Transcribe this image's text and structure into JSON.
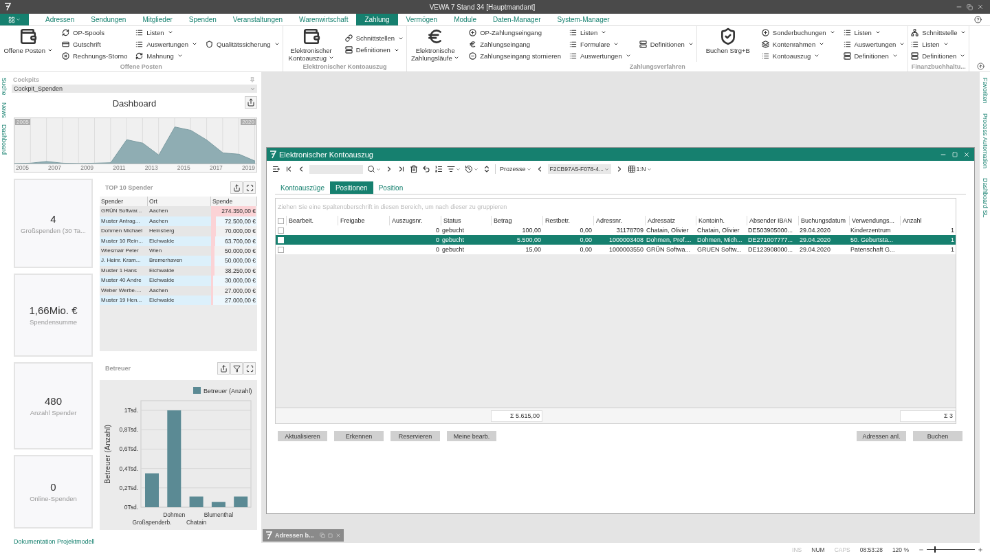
{
  "window": {
    "title": "VEWA 7 Stand 34 [Hauptmandant]"
  },
  "menu_tabs": [
    {
      "label": "Adressen",
      "selected": false
    },
    {
      "label": "Sendungen",
      "selected": false
    },
    {
      "label": "Mitglieder",
      "selected": false
    },
    {
      "label": "Spenden",
      "selected": false
    },
    {
      "label": "Veranstaltungen",
      "selected": false
    },
    {
      "label": "Warenwirtschaft",
      "selected": false
    },
    {
      "label": "Zahlung",
      "selected": true
    },
    {
      "label": "Vermögen",
      "selected": false
    },
    {
      "label": "Module",
      "selected": false
    },
    {
      "label": "Daten-Manager",
      "selected": false
    },
    {
      "label": "System-Manager",
      "selected": false
    }
  ],
  "ribbon": {
    "groups": [
      {
        "label": "Offene Posten",
        "sections": [
          {
            "large": {
              "label": "Offene Posten",
              "dropdown": true
            },
            "columns": [
              [
                {
                  "label": "OP-Spools",
                  "dropdown": false
                },
                {
                  "label": "Gutschrift",
                  "dropdown": false
                },
                {
                  "label": "Rechnungs-Storno",
                  "dropdown": false
                }
              ],
              [
                {
                  "label": "Listen",
                  "dropdown": true
                },
                {
                  "label": "Auswertungen",
                  "dropdown": true
                },
                {
                  "label": "Mahnung",
                  "dropdown": true
                }
              ],
              [
                {
                  "label": "Qualitätssicherung",
                  "dropdown": true
                }
              ]
            ]
          }
        ]
      },
      {
        "label": "Elektronischer Kontoauszug",
        "sections": [
          {
            "large": {
              "label": "Elektronischer Kontoauszug",
              "dropdown": true
            },
            "columns": [
              [
                {
                  "label": "Schnittstellen",
                  "dropdown": true
                },
                {
                  "label": "Definitionen",
                  "dropdown": true
                }
              ]
            ]
          }
        ]
      },
      {
        "label": "Zahlungsverfahren",
        "sections": [
          {
            "large": {
              "label": "Elektronische Zahlungsläufe",
              "dropdown": true
            },
            "columns": [
              [
                {
                  "label": "OP-Zahlungseingang",
                  "dropdown": false
                },
                {
                  "label": "Zahlungseingang",
                  "dropdown": false
                },
                {
                  "label": "Zahlungseingang stornieren",
                  "dropdown": false
                }
              ],
              [
                {
                  "label": "Listen",
                  "dropdown": true
                },
                {
                  "label": "Formulare",
                  "dropdown": true
                },
                {
                  "label": "Auswertungen",
                  "dropdown": true
                }
              ],
              [
                {
                  "label": "Definitionen",
                  "dropdown": true
                }
              ]
            ]
          },
          {
            "large": {
              "label": "Buchen Strg+B",
              "dropdown": false
            },
            "columns": [
              [
                {
                  "label": "Sonderbuchungen",
                  "dropdown": true
                },
                {
                  "label": "Kontenrahmen",
                  "dropdown": true
                },
                {
                  "label": "Kontoauszug",
                  "dropdown": true
                }
              ],
              [
                {
                  "label": "Listen",
                  "dropdown": true
                },
                {
                  "label": "Auswertungen",
                  "dropdown": true
                },
                {
                  "label": "Definitionen",
                  "dropdown": true
                }
              ]
            ]
          }
        ]
      },
      {
        "label": "Finanzbuchhaltu...",
        "sections": [
          {
            "columns": [
              [
                {
                  "label": "Schnittstelle",
                  "dropdown": true
                },
                {
                  "label": "Listen",
                  "dropdown": true
                },
                {
                  "label": "Definitionen",
                  "dropdown": true
                }
              ]
            ]
          }
        ]
      }
    ]
  },
  "side_tabs_left": [
    "Suche",
    "News",
    "Dashboard"
  ],
  "side_tabs_right": [
    "Favoriten",
    "Process Automation",
    "Dashboard SL"
  ],
  "cockpit": {
    "header": "Cockpits",
    "value": "Cockpit_Spenden",
    "title": "Dashboard"
  },
  "range_chart": {
    "start": "2005",
    "end": "2020",
    "x_labels": [
      "2005",
      "2007",
      "2009",
      "2011",
      "2013",
      "2015",
      "2017",
      "2019"
    ]
  },
  "kpis": [
    {
      "value": "4",
      "label": "Großspenden (30 Ta..."
    },
    {
      "value": "1,66Mio. €",
      "label": "Spendensumme"
    },
    {
      "value": "480",
      "label": "Anzahl Spender"
    },
    {
      "value": "0",
      "label": "Online-Spenden"
    }
  ],
  "top_spender": {
    "title": "TOP 10 Spender",
    "columns": [
      "Spender",
      "Ort",
      "Spende"
    ],
    "rows": [
      {
        "spender": "GRÜN Softwar...",
        "ort": "Aachen",
        "spende": "274.350,00 €",
        "level": 1
      },
      {
        "spender": "Muster Antrag...",
        "ort": "Aachen",
        "spende": "72.500,00 €",
        "level": 0.1
      },
      {
        "spender": "Dohmen Michael",
        "ort": "Heinsberg",
        "spende": "70.000,00 €",
        "level": 0.1
      },
      {
        "spender": "Muster 10 Rein...",
        "ort": "Eichwalde",
        "spende": "63.700,00 €",
        "level": 0.09
      },
      {
        "spender": "Wiesmair Peter",
        "ort": "Wien",
        "spende": "50.000,00 €",
        "level": 0.08
      },
      {
        "spender": "J. Heinr. Kram...",
        "ort": "Bremerhaven",
        "spende": "50.000,00 €",
        "level": 0.08
      },
      {
        "spender": "Muster 1 Hans",
        "ort": "Eichwalde",
        "spende": "38.250,00 €",
        "level": 0.07
      },
      {
        "spender": "Muster 40 Andre",
        "ort": "Eichwalde",
        "spende": "30.000,00 €",
        "level": 0.05
      },
      {
        "spender": "Weber Werbe-...",
        "ort": "Aachen",
        "spende": "27.000,00 €",
        "level": 0.05
      },
      {
        "spender": "Muster 19 Hen...",
        "ort": "Eichwalde",
        "spende": "27.000,00 €",
        "level": 0.05
      }
    ]
  },
  "betreuer": {
    "title": "Betreuer",
    "chart_data": {
      "type": "bar",
      "ylabel": "Betreuer (Anzahl)",
      "categories": [
        "Großspenderb.",
        "Dohmen",
        "Chatain",
        "Blumenthal",
        null
      ],
      "series": [
        {
          "name": "Betreuer (Anzahl)",
          "color": "#5b8a94",
          "values": [
            0.35,
            1,
            0.11,
            0.055,
            0.11
          ]
        }
      ],
      "grid": true,
      "ylim": [
        0,
        1.1
      ],
      "yticks": [
        {
          "value": 0,
          "label": "0Tsd."
        },
        {
          "value": 0.2,
          "label": "0,2Tsd."
        },
        {
          "value": 0.4,
          "label": "0,4Tsd."
        },
        {
          "value": 0.6,
          "label": "0,6Tsd."
        },
        {
          "value": 0.8,
          "label": "0,8Tsd."
        },
        {
          "value": 1,
          "label": "1Tsd."
        }
      ]
    }
  },
  "footer_link": "Dokumentation Projektmodell",
  "dialog": {
    "title": "Elektronischer Kontoauszug",
    "toolbar": {
      "prozesse": "Prozesse",
      "record": "F2CB97A5-F078-4...",
      "view": "1:N"
    },
    "tabs": [
      {
        "label": "Kontoauszüge",
        "selected": false
      },
      {
        "label": "Positionen",
        "selected": true
      },
      {
        "label": "Position",
        "selected": false
      }
    ],
    "select_all_checked": false,
    "group_hint": "Ziehen Sie eine Spaltenüberschrift in diesen Bereich, um nach dieser zu gruppieren",
    "columns": [
      "Bearbeit.",
      "Freigabe",
      "Auszugsnr.",
      "Status",
      "Betrag",
      "Restbetr.",
      "Adressnr.",
      "Adressatz",
      "Kontoinh.",
      "Absender IBAN",
      "Buchungsdatum",
      "Verwendungs...",
      "Anzahl"
    ],
    "rows": [
      {
        "checked": false,
        "selected": false,
        "cells": [
          null,
          null,
          "0",
          "gebucht",
          "100,00",
          "0,00",
          "31178709",
          "Chatain, Olivier",
          "Chatain, Olivier",
          "DE503905000...",
          "29.04.2020",
          "Kinderzentrum",
          "1"
        ]
      },
      {
        "checked": false,
        "selected": true,
        "cells": [
          null,
          null,
          "0",
          "gebucht",
          "5.500,00",
          "0,00",
          "1000003408",
          "Dohmen, Prof....",
          "Dohmen, Mich...",
          "DE271007777...",
          "29.04.2020",
          "50. Geburtsta...",
          "1"
        ]
      },
      {
        "checked": false,
        "selected": false,
        "cells": [
          null,
          null,
          "0",
          "gebucht",
          "15,00",
          "0,00",
          "1000003550",
          "GRÜN Softwa...",
          "GRUEN Softw...",
          "DE123908000...",
          "29.04.2020",
          "Patenschaft G...",
          "1"
        ]
      }
    ],
    "sums": [
      "Σ 5.615,00",
      "Σ 3"
    ],
    "buttons_left": [
      "Aktualisieren",
      "Erkennen",
      "Reservieren",
      "Meine bearb."
    ],
    "buttons_right": [
      "Adressen anl.",
      "Buchen"
    ]
  },
  "minimized": [
    {
      "title": "Adressen b..."
    }
  ],
  "status_bar": {
    "keys": [
      {
        "label": "INS",
        "on": false
      },
      {
        "label": "NUM",
        "on": true
      },
      {
        "label": "CAPS",
        "on": false
      }
    ],
    "time": "08:53:28",
    "zoom": "120 %",
    "zoom_slider": {
      "level": 0.15
    }
  }
}
